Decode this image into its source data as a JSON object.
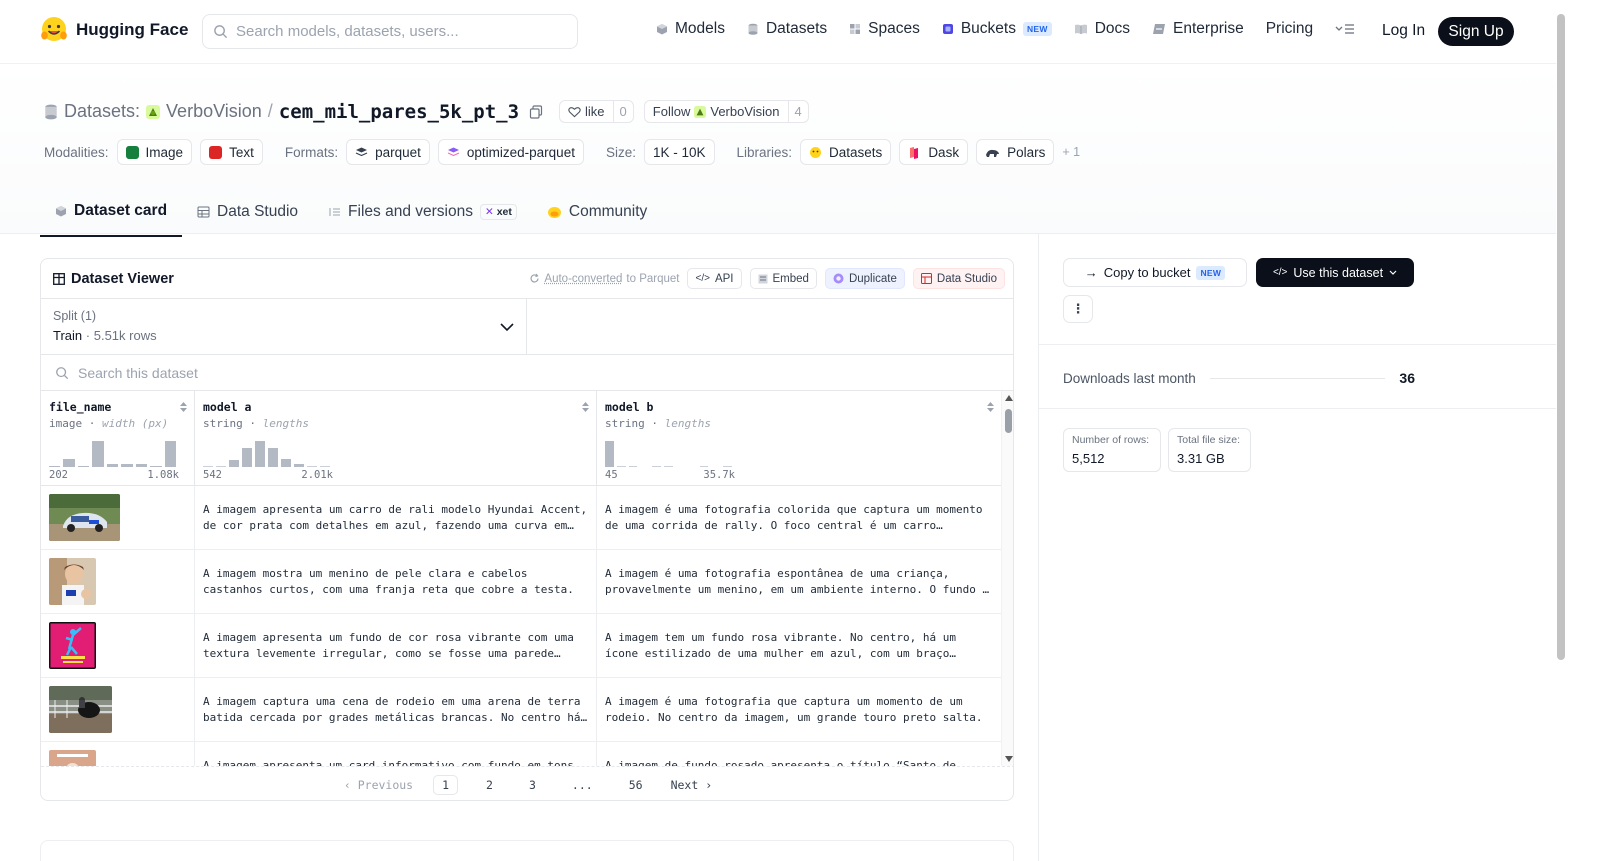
{
  "nav": {
    "brand": "Hugging Face",
    "search_placeholder": "Search models, datasets, users...",
    "links": [
      {
        "label": "Models",
        "icon": "cube-icon"
      },
      {
        "label": "Datasets",
        "icon": "database-icon"
      },
      {
        "label": "Spaces",
        "icon": "grid-icon"
      },
      {
        "label": "Buckets",
        "icon": "bucket-icon",
        "badge": "NEW"
      },
      {
        "label": "Docs",
        "icon": "book-icon"
      },
      {
        "label": "Enterprise",
        "icon": "enterprise-icon"
      },
      {
        "label": "Pricing"
      }
    ],
    "login": "Log In",
    "signup": "Sign Up"
  },
  "header": {
    "prefix": "Datasets:",
    "owner": "VerboVision",
    "slash": "/",
    "name": "cem_mil_pares_5k_pt_3",
    "like_label": "like",
    "like_count": "0",
    "follow_label": "Follow",
    "follow_owner": "VerboVision",
    "follow_count": "4"
  },
  "meta": {
    "modalities_label": "Modalities:",
    "modalities": [
      "Image",
      "Text"
    ],
    "formats_label": "Formats:",
    "formats": [
      "parquet",
      "optimized-parquet"
    ],
    "size_label": "Size:",
    "size": "1K - 10K",
    "libraries_label": "Libraries:",
    "libraries": [
      "Datasets",
      "Dask",
      "Polars"
    ],
    "more": "+ 1"
  },
  "tabs": [
    {
      "label": "Dataset card",
      "active": true
    },
    {
      "label": "Data Studio"
    },
    {
      "label": "Files and versions",
      "badge": "xet"
    },
    {
      "label": "Community"
    }
  ],
  "viewer": {
    "title": "Dataset Viewer",
    "auto_converted": "Auto-converted",
    "to_parquet": " to Parquet",
    "api": "API",
    "embed": "Embed",
    "duplicate": "Duplicate",
    "data_studio": "Data Studio",
    "split_label": "Split (1)",
    "split_name": "Train",
    "split_rows": "5.51k rows",
    "search_placeholder": "Search this dataset",
    "columns": [
      {
        "name": "file_name",
        "type": "image",
        "stat": "width (px)",
        "min": "202",
        "max": "1.08k",
        "hist": [
          0.05,
          0.3,
          0.05,
          1.0,
          0.1,
          0.1,
          0.1,
          0.05,
          1.0
        ]
      },
      {
        "name": "model a",
        "type": "string",
        "stat": "lengths",
        "min": "542",
        "max": "2.01k",
        "hist": [
          0.03,
          0.03,
          0.28,
          0.75,
          1.0,
          0.75,
          0.3,
          0.1,
          0.03,
          0.03
        ]
      },
      {
        "name": "model b",
        "type": "string",
        "stat": "lengths",
        "min": "45",
        "max": "35.7k",
        "hist": [
          1.0,
          0.04,
          0.04,
          0.0,
          0.04,
          0.04,
          0.0,
          0.0,
          0.04,
          0.0,
          0.04
        ]
      }
    ],
    "rows": [
      {
        "img": "rally-car",
        "a": "A imagem apresenta um carro de rali modelo Hyundai Accent, de cor prata com detalhes em azul, fazendo uma curva em uma estrada de terra.",
        "b": "A imagem é uma fotografia colorida que captura um momento de uma corrida de rally. O foco central é um carro prateado."
      },
      {
        "img": "boy",
        "a": "A imagem mostra um menino de pele clara e cabelos castanhos curtos, com uma franja reta que cobre a testa.",
        "b": "A imagem é uma fotografia espontânea de uma criança, provavelmente um menino, em um ambiente interno. O fundo é claro."
      },
      {
        "img": "pink-poster",
        "a": "A imagem apresenta um fundo de cor rosa vibrante com uma textura levemente irregular, como se fosse uma parede pintada.",
        "b": "A imagem tem um fundo rosa vibrante. No centro, há um ícone estilizado de uma mulher em azul, com um braço levantado."
      },
      {
        "img": "rodeo",
        "a": "A imagem captura uma cena de rodeio em uma arena de terra batida cercada por grades metálicas brancas. No centro há um touro.",
        "b": "A imagem é uma fotografia que captura um momento de um rodeio. No centro da imagem, um grande touro preto salta."
      },
      {
        "img": "card",
        "a": "A imagem apresenta um card informativo com fundo em tons rosados e o título em destaque.",
        "b": "A imagem de fundo rosado apresenta o título “Santo de casa” em letras grandes."
      }
    ],
    "pager": {
      "prev": "Previous",
      "pages": [
        "1",
        "2",
        "3",
        "...",
        "56"
      ],
      "next": "Next"
    }
  },
  "side": {
    "copy_bucket": "Copy to bucket",
    "copy_badge": "NEW",
    "use_dataset": "Use this dataset",
    "more": "⋮",
    "downloads_label": "Downloads last month",
    "downloads": "36",
    "rows_label": "Number of rows:",
    "rows_value": "5,512",
    "size_label": "Total file size:",
    "size_value": "3.31 GB"
  }
}
